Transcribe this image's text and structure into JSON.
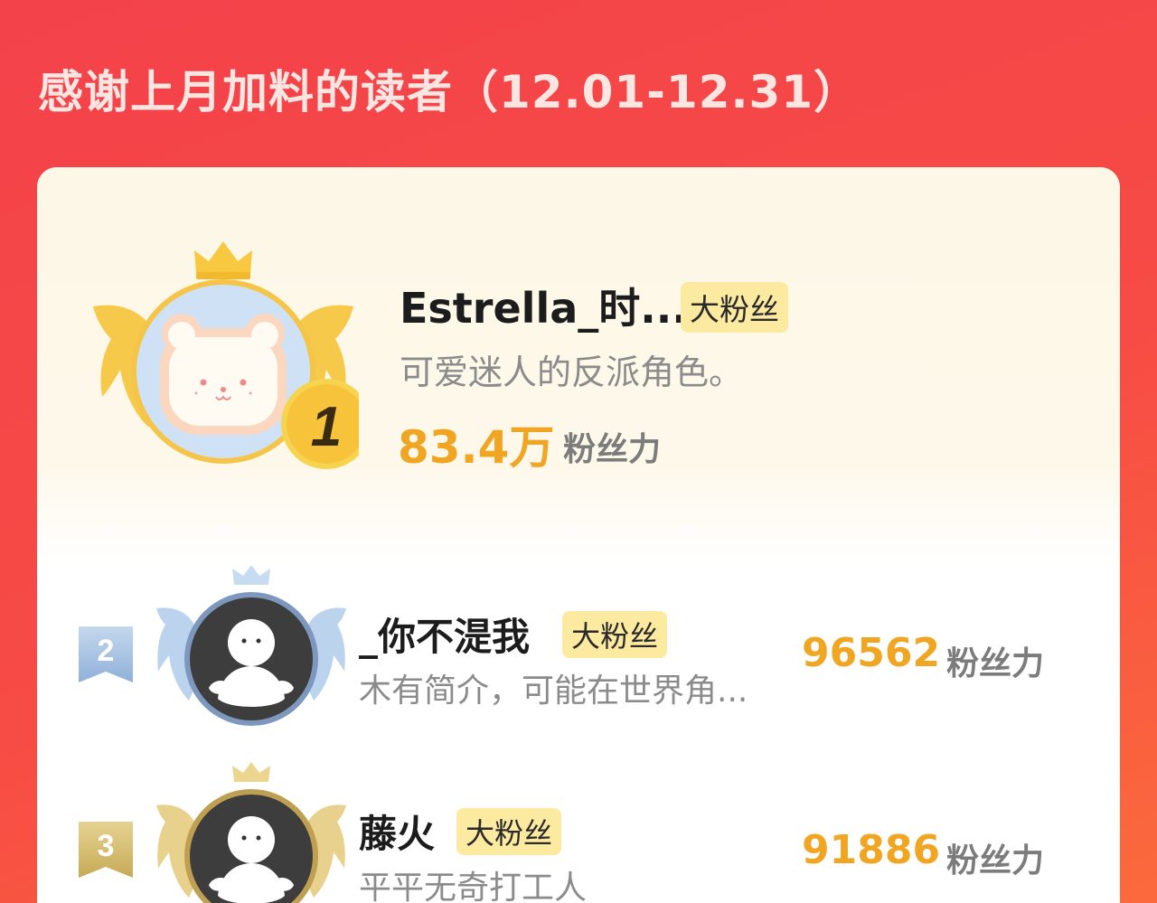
{
  "header": {
    "title": "感谢上月加料的读者（12.01-12.31）"
  },
  "ranking": {
    "badge_label": "大粉丝",
    "unit_label": "粉丝力",
    "entries": [
      {
        "rank": "1",
        "name": "Estrella_时...",
        "bio": "可爱迷人的反派角色。",
        "score": "83.4万",
        "avatar_icon": "bear-toast-avatar-icon"
      },
      {
        "rank": "2",
        "name": "_你不湜我",
        "bio": "木有简介，可能在世界角...",
        "score": "96562",
        "avatar_icon": "default-person-avatar-icon"
      },
      {
        "rank": "3",
        "name": "藤火",
        "bio": "平平无奇打工人",
        "score": "91886",
        "avatar_icon": "default-person-avatar-icon"
      }
    ]
  },
  "colors": {
    "background": "#f3424a",
    "score": "#f0a623",
    "badge_bg": "#fbeaa0",
    "gold": "#f6c33a",
    "silver_blue": "#aac6e6",
    "bronze": "#c9ac5f"
  }
}
